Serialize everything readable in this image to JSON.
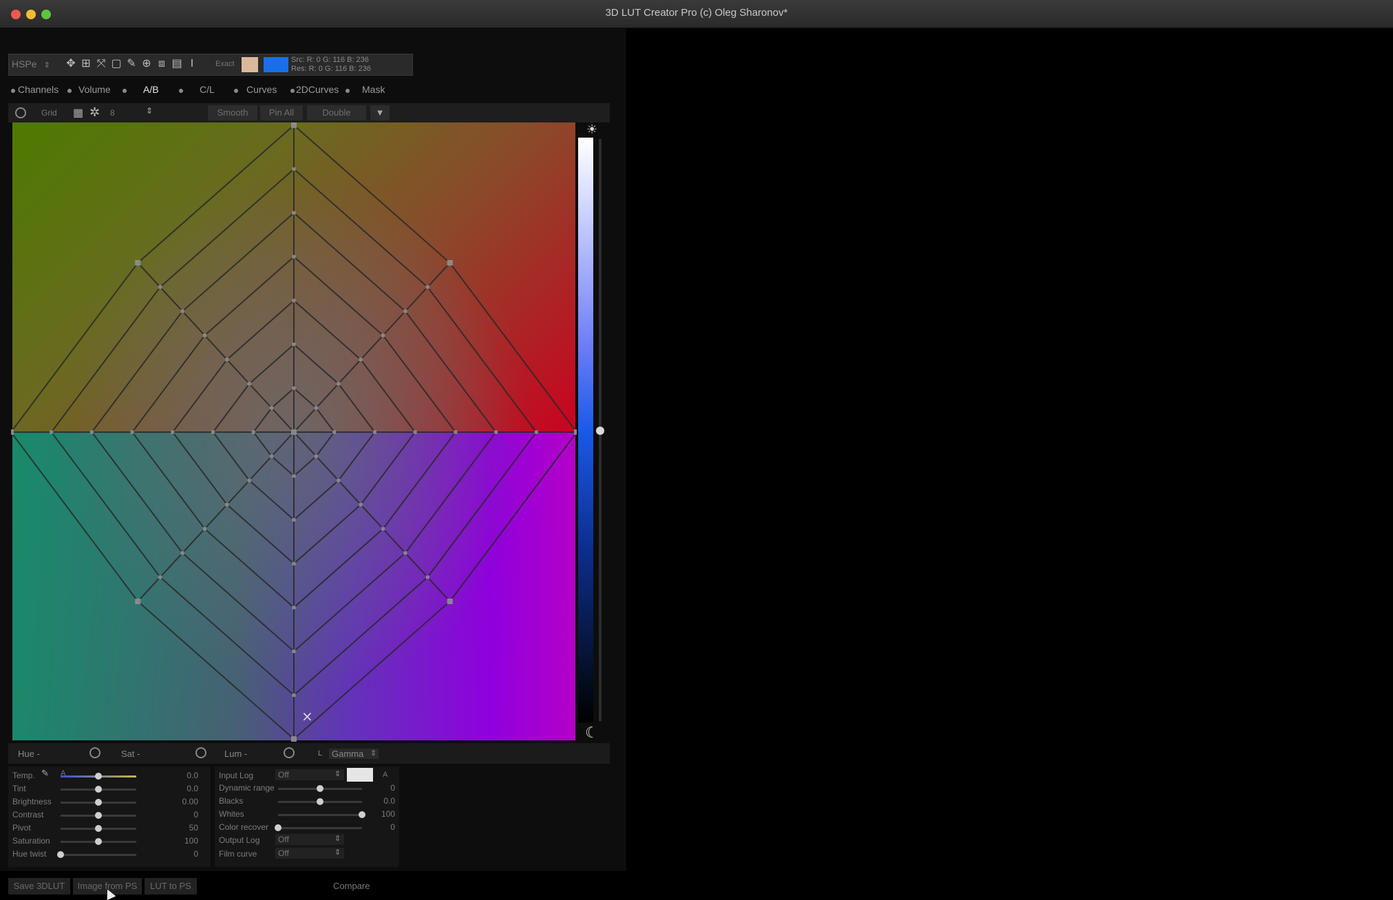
{
  "window": {
    "title": "3D LUT Creator Pro (c) Oleg Sharonov*"
  },
  "toolbar": {
    "mode_select": "HSPe",
    "exact_label": "Exact",
    "src_readout": "Src: R:   0     G: 116   B: 236",
    "res_readout": "Res: R:   0     G: 116   B: 236",
    "swatch_src_color": "#dab99a",
    "swatch_res_color": "#1a6fe8"
  },
  "tabs": [
    {
      "label": "Channels"
    },
    {
      "label": "Volume"
    },
    {
      "label": "A/B",
      "active": true
    },
    {
      "label": "C/L"
    },
    {
      "label": "Curves"
    },
    {
      "label": "2DCurves"
    },
    {
      "label": "Mask"
    }
  ],
  "subbar": {
    "grid_label": "Grid",
    "grid_value": "8",
    "smooth_label": "Smooth",
    "pin_all_label": "Pin All",
    "double_label": "Double"
  },
  "hsl_bar": {
    "hue": "Hue -",
    "sat": "Sat -",
    "lum": "Lum -",
    "gamma_prefix": "L",
    "gamma": "Gamma"
  },
  "left_controls": [
    {
      "label": "Temp.",
      "value": "0.0",
      "level": 0.5
    },
    {
      "label": "Tint",
      "value": "0.0",
      "level": 0.5
    },
    {
      "label": "Brightness",
      "value": "0.00",
      "level": 0.5
    },
    {
      "label": "Contrast",
      "value": "0",
      "level": 0.5
    },
    {
      "label": "Pivot",
      "value": "50",
      "level": 0.5
    },
    {
      "label": "Saturation",
      "value": "100",
      "level": 0.5
    },
    {
      "label": "Hue twist",
      "value": "0",
      "level": 0.0
    }
  ],
  "temp_auto_label": "A",
  "right_controls": {
    "input_log": {
      "label": "Input Log",
      "value": "Off"
    },
    "dynamic_range": {
      "label": "Dynamic range",
      "value": "0",
      "level": 0.5
    },
    "blacks": {
      "label": "Blacks",
      "value": "0.0",
      "level": 0.5
    },
    "whites": {
      "label": "Whites",
      "value": "100",
      "level": 1.0
    },
    "color_recover": {
      "label": "Color recover",
      "value": "0",
      "level": 0.0
    },
    "output_log": {
      "label": "Output Log",
      "value": "Off"
    },
    "film_curve": {
      "label": "Film curve",
      "value": "Off"
    },
    "auto_label": "A"
  },
  "bottom_buttons": {
    "save_3dlut": "Save 3DLUT",
    "image_from_ps": "Image from PS",
    "lut_to_ps": "LUT to PS",
    "compare": "Compare"
  },
  "icons": [
    "move-icon",
    "crop-icon",
    "zoom-icon",
    "sun-icon",
    "moon-icon",
    "reset-icon",
    "eyedropper-icon",
    "dropdown-arrow-icon"
  ]
}
